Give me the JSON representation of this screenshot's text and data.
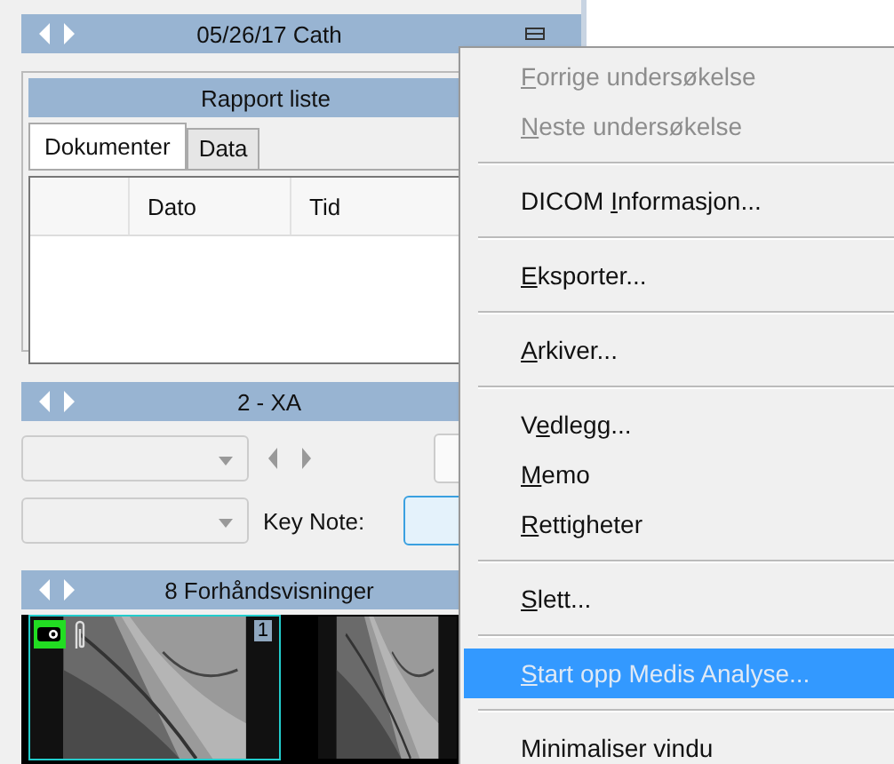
{
  "study_header": {
    "title": "05/26/17 Cath"
  },
  "report_list": {
    "title": "Rapport liste",
    "tabs": [
      {
        "label": "Dokumenter",
        "selected": true
      },
      {
        "label": "Data",
        "selected": false
      }
    ],
    "columns": [
      "Dato",
      "Tid"
    ]
  },
  "series_header": {
    "title": "2 - XA"
  },
  "key_note": {
    "label": "Key Note:"
  },
  "preview_header": {
    "title": "8 Forhåndsvisninger"
  },
  "thumbnails": [
    {
      "number": "1",
      "selected": true
    },
    {
      "selected": false
    }
  ],
  "context_menu": [
    {
      "kind": "item",
      "key": "F",
      "post": "orrige undersøkelse",
      "disabled": true,
      "selected": false
    },
    {
      "kind": "item",
      "key": "N",
      "post": "este undersøkelse",
      "disabled": true,
      "selected": false
    },
    {
      "kind": "separator"
    },
    {
      "kind": "item",
      "pre": "DICOM ",
      "key": "I",
      "post": "nformasjon...",
      "disabled": false,
      "selected": false
    },
    {
      "kind": "separator"
    },
    {
      "kind": "item",
      "key": "E",
      "post": "ksporter...",
      "disabled": false,
      "selected": false
    },
    {
      "kind": "separator"
    },
    {
      "kind": "item",
      "key": "A",
      "post": "rkiver...",
      "disabled": false,
      "selected": false
    },
    {
      "kind": "separator"
    },
    {
      "kind": "item",
      "pre": "V",
      "key": "e",
      "post": "dlegg...",
      "disabled": false,
      "selected": false
    },
    {
      "kind": "item",
      "key": "M",
      "post": "emo",
      "disabled": false,
      "selected": false
    },
    {
      "kind": "item",
      "key": "R",
      "post": "ettigheter",
      "disabled": false,
      "selected": false
    },
    {
      "kind": "separator"
    },
    {
      "kind": "item",
      "key": "S",
      "post": "lett...",
      "disabled": false,
      "selected": false
    },
    {
      "kind": "separator"
    },
    {
      "kind": "item",
      "key": "S",
      "post": "tart opp Medis Analyse...",
      "disabled": false,
      "selected": true
    },
    {
      "kind": "separator"
    },
    {
      "kind": "item",
      "pre": "Minimaliser vindu",
      "disabled": false,
      "selected": false
    }
  ]
}
